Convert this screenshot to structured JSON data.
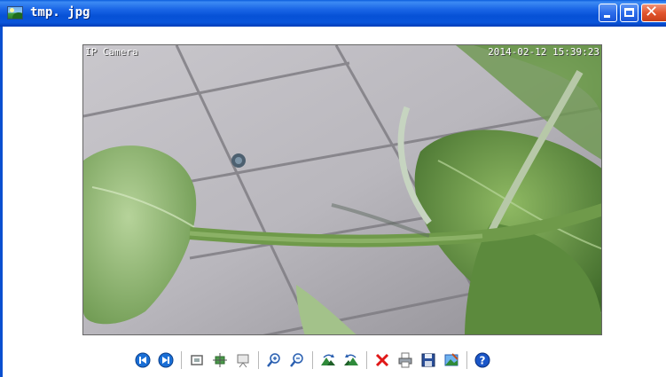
{
  "window": {
    "title": "tmp. jpg"
  },
  "photo": {
    "overlay_left": "IP Camera",
    "overlay_right": "2014-02-12 15:39:23"
  },
  "toolbar": {
    "buttons": [
      {
        "icon": "previous-image-icon"
      },
      {
        "icon": "next-image-icon"
      },
      {
        "icon": "best-fit-icon"
      },
      {
        "icon": "actual-size-icon"
      },
      {
        "icon": "slideshow-icon"
      },
      {
        "icon": "zoom-in-icon"
      },
      {
        "icon": "zoom-out-icon"
      },
      {
        "icon": "rotate-clockwise-icon"
      },
      {
        "icon": "rotate-counterclockwise-icon"
      },
      {
        "icon": "delete-icon"
      },
      {
        "icon": "print-icon"
      },
      {
        "icon": "save-icon"
      },
      {
        "icon": "open-with-icon"
      },
      {
        "icon": "help-icon"
      }
    ]
  },
  "colors": {
    "titlebar": "#0a55da",
    "close_button": "#e2552d",
    "toolbar_nav": "#1a6fd6",
    "delete": "#e01818"
  }
}
